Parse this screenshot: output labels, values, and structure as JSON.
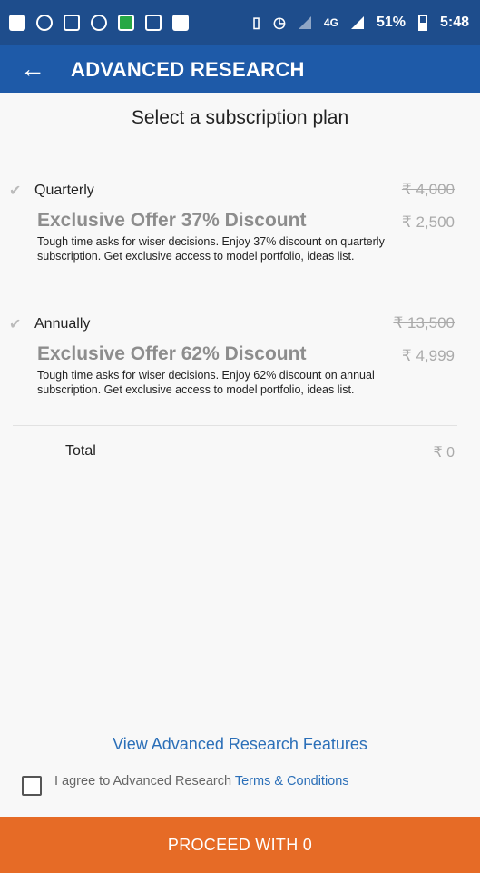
{
  "status_bar": {
    "network": "4G",
    "battery": "51%",
    "time": "5:48"
  },
  "app_bar": {
    "back_icon": "arrow-left-icon",
    "title": "ADVANCED RESEARCH"
  },
  "heading": "Select a subscription plan",
  "plans": [
    {
      "name": "Quarterly",
      "original_price": "₹ 4,000",
      "offer_title": "Exclusive Offer 37% Discount",
      "price": "₹ 2,500",
      "description": "Tough time asks for wiser decisions. Enjoy 37% discount on quarterly subscription. Get exclusive access to model portfolio, ideas list."
    },
    {
      "name": "Annually",
      "original_price": "₹ 13,500",
      "offer_title": "Exclusive Offer 62% Discount",
      "price": "₹ 4,999",
      "description": "Tough time asks for wiser decisions. Enjoy 62% discount on annual subscription. Get exclusive access to model portfolio, ideas list."
    }
  ],
  "total": {
    "label": "Total",
    "value": "₹ 0"
  },
  "features_link": "View Advanced Research Features",
  "agreement": {
    "text": "I agree to Advanced Research ",
    "link": "Terms & Conditions",
    "checked": false
  },
  "proceed_button": "PROCEED WITH 0",
  "colors": {
    "status_bar": "#1e4d8c",
    "app_bar": "#1e5aa8",
    "accent_orange": "#e66b26",
    "link_blue": "#2b6fb8"
  }
}
